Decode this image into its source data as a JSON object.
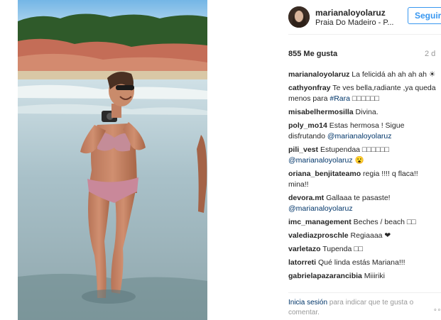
{
  "post": {
    "username": "marianaloyolaruz",
    "location": "Praia Do Madeiro - P...",
    "follow_label": "Seguir",
    "likes": "855 Me gusta",
    "time_ago": "2 d"
  },
  "comments": [
    {
      "user": "marianaloyolaruz",
      "text": " La felicidá ah ah ah ah ☀"
    },
    {
      "user": "cathyonfray",
      "text": " Te ves bella,radiante ,ya queda menos para ",
      "mention": "#Rara",
      "tail": " □□□□□□"
    },
    {
      "user": "misabelhermosilla",
      "text": " Divina."
    },
    {
      "user": "poly_mo14",
      "text": " Estas hermosa ! Sigue disfrutando ",
      "mention": "@marianaloyolaruz",
      "tail": ""
    },
    {
      "user": "pili_vest",
      "text": " Estupendaa □□□□□□ ",
      "mention": "@marianaloyolaruz",
      "tail": " 😮"
    },
    {
      "user": "oriana_benjitateamo",
      "text": " regia !!!! q flaca!! mina!!"
    },
    {
      "user": "devora.mt",
      "text": " Gallaaa te pasaste! ",
      "mention": "@marianaloyolaruz",
      "tail": ""
    },
    {
      "user": "imc_management",
      "text": " Beches / beach □□"
    },
    {
      "user": "valediazproschle",
      "text": " Regiaaaa ❤"
    },
    {
      "user": "varletazo",
      "text": " Tupenda □□"
    },
    {
      "user": "latorreti",
      "text": " Qué linda estás Mariana!!!"
    },
    {
      "user": "gabrielapazarancibia",
      "text": " Miiiriki"
    }
  ],
  "footer": {
    "login_link": "Inicia sesión",
    "login_text": " para indicar que te gusta o comentar.",
    "more": "∘∘∘"
  },
  "colors": {
    "accent": "#3897f0",
    "link": "#003569",
    "muted": "#999999"
  }
}
